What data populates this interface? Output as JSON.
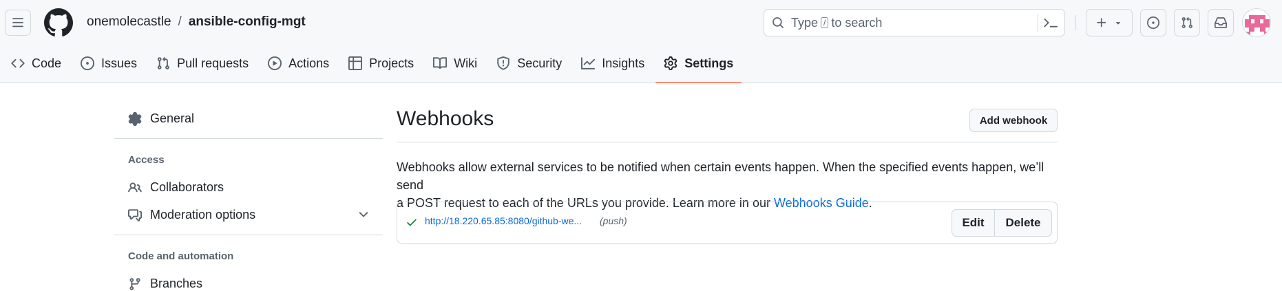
{
  "header": {
    "owner": "onemolecastle",
    "separator": "/",
    "repo": "ansible-config-mgt",
    "search_text_before": "Type",
    "search_kbd": "/",
    "search_text_after": "to search"
  },
  "nav": {
    "tabs": [
      {
        "label": "Code",
        "icon": "code-icon"
      },
      {
        "label": "Issues",
        "icon": "issue-icon"
      },
      {
        "label": "Pull requests",
        "icon": "pull-request-icon"
      },
      {
        "label": "Actions",
        "icon": "play-icon"
      },
      {
        "label": "Projects",
        "icon": "table-icon"
      },
      {
        "label": "Wiki",
        "icon": "book-icon"
      },
      {
        "label": "Security",
        "icon": "shield-icon"
      },
      {
        "label": "Insights",
        "icon": "graph-icon"
      },
      {
        "label": "Settings",
        "icon": "gear-icon",
        "selected": true
      }
    ]
  },
  "sidebar": {
    "general": "General",
    "access_heading": "Access",
    "collaborators": "Collaborators",
    "moderation": "Moderation options",
    "code_heading": "Code and automation",
    "branches": "Branches"
  },
  "main": {
    "title": "Webhooks",
    "add_button": "Add webhook",
    "description_line1": "Webhooks allow external services to be notified when certain events happen. When the specified events happen, we’ll send",
    "description_line2": "a POST request to each of the URLs you provide. Learn more in our",
    "guide_link": "Webhooks Guide",
    "period": ".",
    "hook": {
      "url": "http://18.220.65.85:8080/github-we...",
      "events": "(push)",
      "status": "success",
      "edit_label": "Edit",
      "delete_label": "Delete"
    }
  },
  "colors": {
    "accent_link": "#0969da",
    "success": "#1a7f37",
    "selected_underline": "#fd8c73",
    "header_bg": "#f6f8fa"
  }
}
